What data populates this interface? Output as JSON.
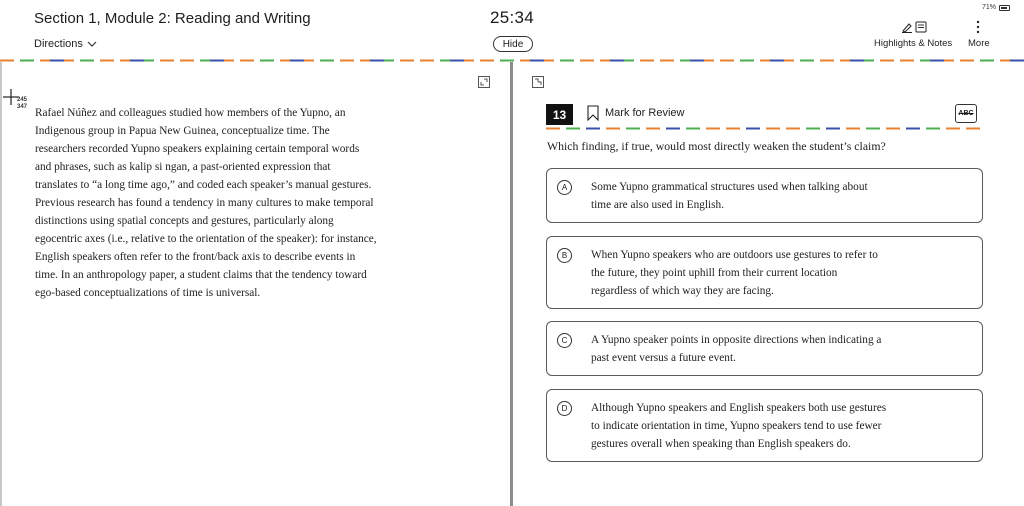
{
  "header": {
    "section_title": "Section 1, Module 2: Reading and Writing",
    "directions_label": "Directions",
    "timer": "25:34",
    "hide_label": "Hide",
    "battery": "71%",
    "highlights_label": "Highlights & Notes",
    "more_label": "More"
  },
  "passage": {
    "line_numbers": [
      "245",
      "347"
    ],
    "text_lines": "Rafael Núñez and colleagues studied how members of the Yupno, an\nIndigenous group in Papua New Guinea, conceptualize time. The\nresearchers recorded Yupno speakers explaining certain temporal words\nand phrases, such as kalip si ngan, a past-oriented expression that\ntranslates to “a long time ago,” and coded each speaker’s manual gestures.\nPrevious research has found a tendency in many cultures to make temporal\ndistinctions using spatial concepts and gestures, particularly along\negocentric axes (i.e., relative to the orientation of the speaker): for instance,\nEnglish speakers often refer to the front/back axis to describe events in\ntime. In an anthropology paper, a student claims that the tendency toward\nego-based conceptualizations of time is universal."
  },
  "question": {
    "number": "13",
    "mark_label": "Mark for Review",
    "abc_label": "ABC",
    "prompt": "Which finding, if true, would most directly weaken the student’s claim?",
    "choices": [
      {
        "letter": "A",
        "text": "Some Yupno grammatical structures used when talking about\ntime are also used in English."
      },
      {
        "letter": "B",
        "text": "When Yupno speakers who are outdoors use gestures to refer to\nthe future, they point uphill from their current location\nregardless of which way they are facing."
      },
      {
        "letter": "C",
        "text": "A Yupno speaker points in opposite directions when indicating a\npast event versus a future event."
      },
      {
        "letter": "D",
        "text": "Although Yupno speakers and English speakers both use gestures\nto indicate orientation in time, Yupno speakers tend to use fewer\ngestures overall when speaking than English speakers do."
      }
    ]
  },
  "colors": {
    "dash_orange": "#e8812f",
    "dash_blue": "#3a4fa8",
    "dash_green": "#4caf50",
    "dash_grey": "#9e9e9e"
  }
}
